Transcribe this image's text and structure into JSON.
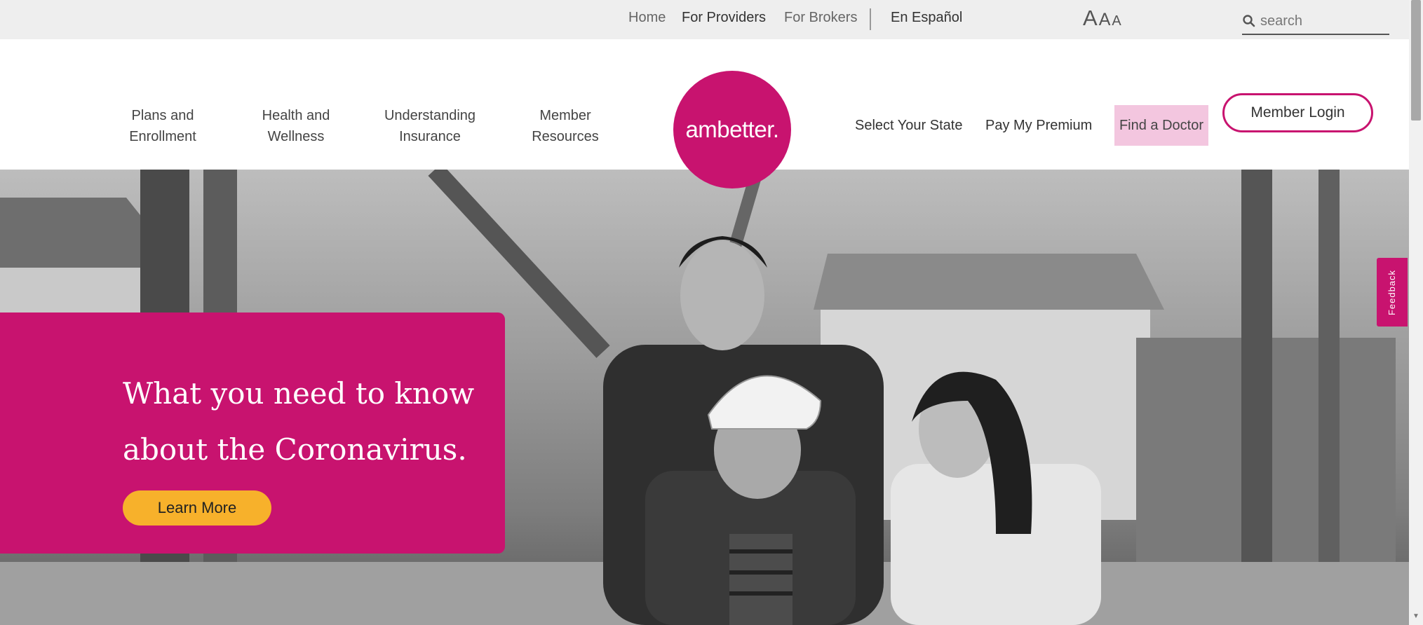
{
  "utility": {
    "home": "Home",
    "providers": "For Providers",
    "brokers": "For Brokers",
    "espanol": "En Español",
    "text_size": [
      "A",
      "A",
      "A"
    ],
    "search_placeholder": "search"
  },
  "nav": {
    "plans": [
      "Plans and",
      "Enrollment"
    ],
    "health": [
      "Health and",
      "Wellness"
    ],
    "insurance": [
      "Understanding",
      "Insurance"
    ],
    "member": [
      "Member",
      "Resources"
    ]
  },
  "logo": {
    "text": "ambetter."
  },
  "header_right": {
    "select_state": "Select Your State",
    "pay_premium": "Pay My Premium",
    "find_doctor": "Find a Doctor",
    "member_login": "Member Login"
  },
  "hero": {
    "title_line1": "What you need to know",
    "title_line2": "about the Coronavirus.",
    "cta": "Learn More"
  },
  "feedback": {
    "label": "Feedback"
  },
  "colors": {
    "brand_magenta": "#c8136f",
    "cta_yellow": "#f7b12b",
    "highlight_pink": "#f3c6df"
  },
  "icons": [
    "search-icon",
    "scroll-up-icon",
    "scroll-down-icon"
  ]
}
